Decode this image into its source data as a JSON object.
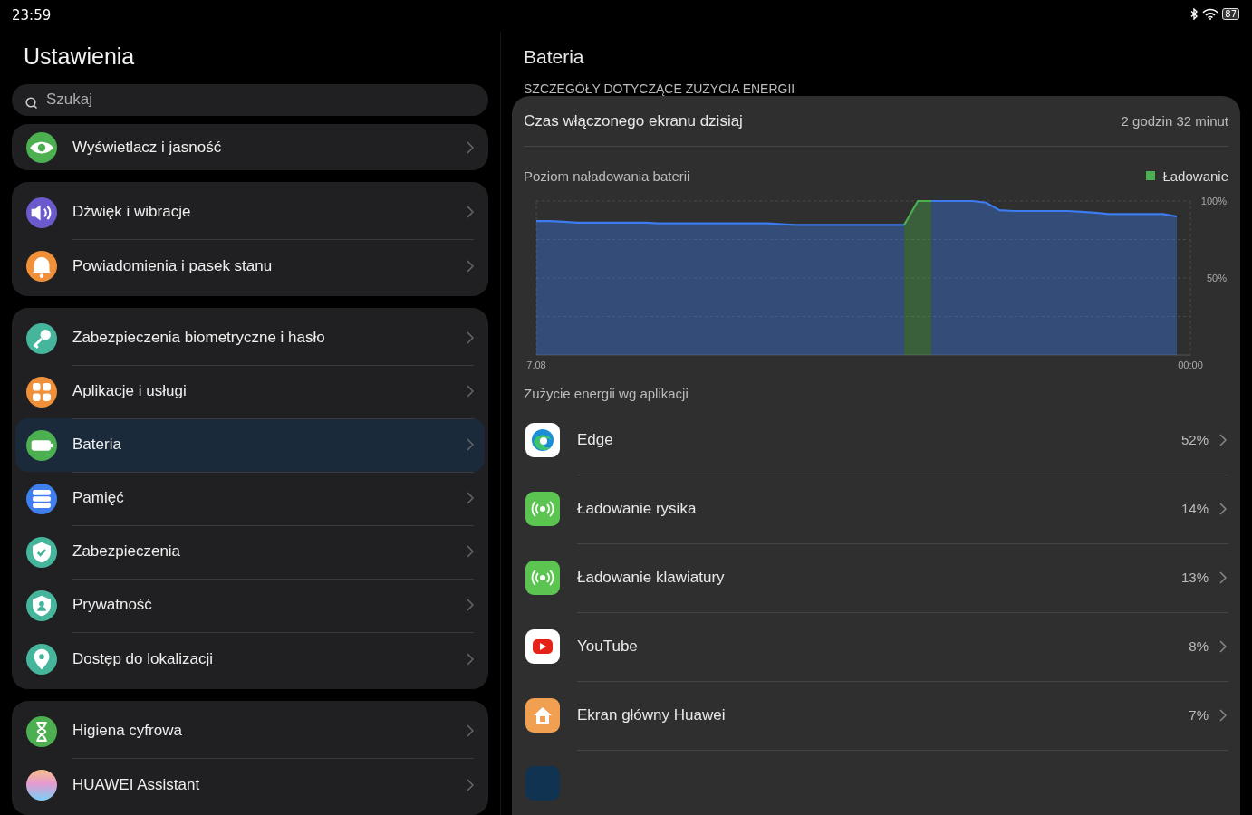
{
  "status_bar": {
    "time": "23:59",
    "battery": "87"
  },
  "sidebar": {
    "title": "Ustawienia",
    "search": {
      "placeholder": "Szukaj"
    },
    "groups": [
      {
        "items": [
          {
            "label": "Wyświetlacz i jasność",
            "kind": "eye",
            "color": "#4caf50",
            "selected": false
          }
        ]
      },
      {
        "items": [
          {
            "label": "Dźwięk i wibracje",
            "kind": "speaker",
            "color": "#6a5acd",
            "selected": false
          },
          {
            "label": "Powiadomienia i pasek stanu",
            "kind": "bell",
            "color": "#f0913a",
            "selected": false
          }
        ]
      },
      {
        "items": [
          {
            "label": "Zabezpieczenia biometryczne i hasło",
            "kind": "key",
            "color": "#45b59b",
            "selected": false
          },
          {
            "label": "Aplikacje i usługi",
            "kind": "grid",
            "color": "#f0913a",
            "selected": false
          },
          {
            "label": "Bateria",
            "kind": "battery",
            "color": "#4caf50",
            "selected": true
          },
          {
            "label": "Pamięć",
            "kind": "storage",
            "color": "#3f7ff0",
            "selected": false
          },
          {
            "label": "Zabezpieczenia",
            "kind": "shield",
            "color": "#45b59b",
            "selected": false
          },
          {
            "label": "Prywatność",
            "kind": "privacy",
            "color": "#45b59b",
            "selected": false
          },
          {
            "label": "Dostęp do lokalizacji",
            "kind": "pin",
            "color": "#45b59b",
            "selected": false
          }
        ]
      },
      {
        "items": [
          {
            "label": "Higiena cyfrowa",
            "kind": "hourglass",
            "color": "#4caf50",
            "selected": false
          },
          {
            "label": "HUAWEI Assistant",
            "kind": "assistant",
            "color": "#e59ad0",
            "selected": false
          }
        ]
      }
    ]
  },
  "detail": {
    "title": "Bateria",
    "section": "SZCZEGÓŁY DOTYCZĄCE ZUŻYCIA ENERGII",
    "screen_time": {
      "label": "Czas włączonego ekranu dzisiaj",
      "value": "2 godzin 32 minut"
    },
    "chart_data": {
      "type": "area",
      "title": "Poziom naładowania baterii",
      "categories": [
        "7.08",
        null,
        null,
        null,
        null,
        null,
        null,
        null,
        null,
        null,
        null,
        null,
        null,
        null,
        null,
        null,
        null,
        null,
        null,
        null,
        null,
        null,
        null,
        null,
        null,
        null,
        null,
        null,
        null,
        null,
        null,
        null,
        null,
        null,
        null,
        null,
        null,
        null,
        null,
        null,
        null,
        null,
        null,
        null,
        null,
        null,
        null,
        null,
        "00:00"
      ],
      "series": [
        {
          "color": "#3d7bf0",
          "values": [
            87,
            87,
            86.5,
            86,
            86,
            86,
            86,
            86,
            86,
            85.5,
            85.5,
            85.5,
            85.5,
            85.5,
            85.5,
            85.5,
            85.5,
            85.5,
            85,
            84.5,
            84.5,
            84.5,
            84.5,
            84.5,
            84.5,
            84.5,
            84.5,
            84.5,
            null,
            100,
            100,
            100,
            100,
            99,
            94,
            93.5,
            93.5,
            93.5,
            93.5,
            93.5,
            93,
            92.5,
            91.5,
            91.5,
            91.5,
            91.5,
            91.5,
            90,
            null
          ]
        },
        {
          "name": "Ładowanie",
          "color": "#4caf50",
          "values": [
            null,
            null,
            null,
            null,
            null,
            null,
            null,
            null,
            null,
            null,
            null,
            null,
            null,
            null,
            null,
            null,
            null,
            null,
            null,
            null,
            null,
            null,
            null,
            null,
            null,
            null,
            null,
            84.5,
            100,
            100,
            null,
            null,
            null,
            null,
            null,
            null,
            null,
            null,
            null,
            null,
            null,
            null,
            null,
            null,
            null,
            null,
            null,
            null,
            null
          ]
        }
      ],
      "ylim": [
        0,
        100
      ],
      "yticks": [
        {
          "value": 100,
          "label": "100%"
        },
        {
          "value": 50,
          "label": "50%"
        }
      ]
    },
    "apps_heading": "Zużycie energii wg aplikacji",
    "apps": [
      {
        "name": "Edge",
        "percent": "52%",
        "kind": "edge"
      },
      {
        "name": "Ładowanie rysika",
        "percent": "14%",
        "kind": "charging"
      },
      {
        "name": "Ładowanie klawiatury",
        "percent": "13%",
        "kind": "charging"
      },
      {
        "name": "YouTube",
        "percent": "8%",
        "kind": "youtube"
      },
      {
        "name": "Ekran główny Huawei",
        "percent": "7%",
        "kind": "home"
      },
      {
        "kind": "generic"
      }
    ]
  }
}
